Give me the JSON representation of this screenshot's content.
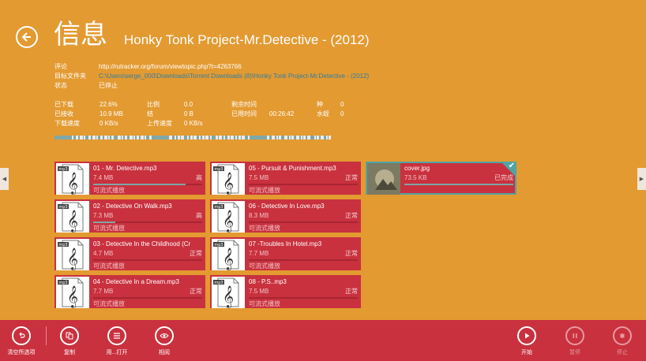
{
  "header": {
    "title": "信息",
    "subtitle": "Honky Tonk Project-Mr.Detective - (2012)"
  },
  "info": [
    {
      "label": "评论",
      "value": "http://rutracker.org/forum/viewtopic.php?t=4263766",
      "link": false
    },
    {
      "label": "目标文件夹",
      "value": "C:\\Users\\serge_000\\Downloads\\Torrent Downloads (8)\\Honky Tonk Project-Mr.Detective - (2012)",
      "link": true
    },
    {
      "label": "状态",
      "value": "已停止",
      "link": false
    }
  ],
  "stats": {
    "downloaded_label": "已下载",
    "downloaded": "22.6%",
    "received_label": "已接收",
    "received": "10.9 MB",
    "dl_speed_label": "下载速度",
    "dl_speed": "0 KB/s",
    "ratio_label": "比例",
    "ratio": "0.0",
    "uploaded_label": "结",
    "uploaded": "0 B",
    "ul_speed_label": "上传速度",
    "ul_speed": "0 KB/s",
    "remaining_label": "剩余时间",
    "remaining": "",
    "elapsed_label": "已用时间",
    "elapsed": "00:26:42",
    "seeds_label": "种",
    "seeds": "0",
    "leechers_label": "水蛭",
    "leechers": "0"
  },
  "nav": {
    "prev_icon": "chevron-left-icon",
    "next_icon": "chevron-right-icon"
  },
  "files": [
    {
      "name": "01 - Mr. Detective.mp3",
      "size": "7.4 MB",
      "priority": "高",
      "status": "可流式播放",
      "progress": 0.85,
      "thumb": "mp3-file-icon"
    },
    {
      "name": "02 - Detective On Walk.mp3",
      "size": "7.3 MB",
      "priority": "高",
      "status": "可流式播放",
      "progress": 0.2,
      "thumb": "mp3-file-icon"
    },
    {
      "name": "03 - Detective In the Childhood (Cr",
      "size": "4.7 MB",
      "priority": "正常",
      "status": "可流式播放",
      "progress": 0.0,
      "thumb": "mp3-file-icon"
    },
    {
      "name": "04 - Detective In a Dream.mp3",
      "size": "7.7 MB",
      "priority": "正常",
      "status": "可流式播放",
      "progress": 0.0,
      "thumb": "mp3-file-icon"
    },
    {
      "name": "05 - Pursuit & Punishment.mp3",
      "size": "7.5 MB",
      "priority": "正常",
      "status": "可流式播放",
      "progress": 0.0,
      "thumb": "mp3-file-icon"
    },
    {
      "name": "06 - Detective In Love.mp3",
      "size": "8.3 MB",
      "priority": "正常",
      "status": "可流式播放",
      "progress": 0.0,
      "thumb": "mp3-file-icon"
    },
    {
      "name": "07 -Troubles In Hotel.mp3",
      "size": "7.7 MB",
      "priority": "正常",
      "status": "可流式播放",
      "progress": 0.0,
      "thumb": "mp3-file-icon"
    },
    {
      "name": "08 - P.S..mp3",
      "size": "7.5 MB",
      "priority": "正常",
      "status": "可流式播放",
      "progress": 0.0,
      "thumb": "mp3-file-icon"
    },
    {
      "name": "cover.jpg",
      "size": "73.5 KB",
      "priority": "已完成",
      "status": "",
      "progress": 1.0,
      "thumb": "image-thumbnail",
      "selected": true
    }
  ],
  "appbar": {
    "clear_selection": "清空所选项",
    "copy": "复制",
    "open_with": "用...打开",
    "view": "相阅",
    "start": "开始",
    "pause": "暂停",
    "stop": "停止"
  },
  "colors": {
    "background": "#e39a31",
    "tile": "#c9313e",
    "accent": "#4fa5a3",
    "link": "#2f7fa3"
  }
}
